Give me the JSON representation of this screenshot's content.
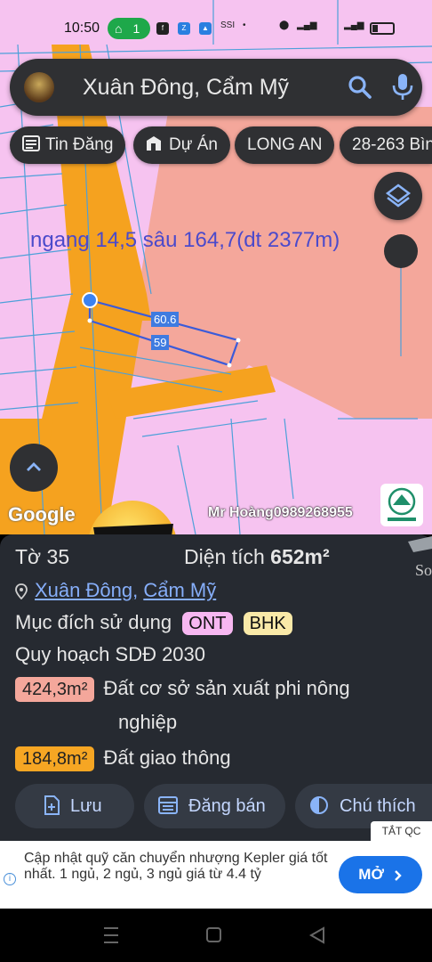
{
  "status": {
    "time": "10:50",
    "hotspot_count": "1"
  },
  "search": {
    "query": "Xuân Đông, Cẩm Mỹ"
  },
  "chips": [
    {
      "label": "Tin Đăng",
      "icon": "newspaper-icon"
    },
    {
      "label": "Dự Án",
      "icon": "building-icon"
    },
    {
      "label": "LONG AN",
      "icon": ""
    },
    {
      "label": "28-263 Bìn",
      "icon": ""
    }
  ],
  "map": {
    "dimension_label": "ngang 14,5 sâu 164,7(dt 2377m)",
    "measure_top": "60.6",
    "measure_bottom": "59",
    "google_logo": "Google",
    "watermark": "Mr Hoàng0989268955",
    "colors": {
      "land_pink": "#f6c3f0",
      "parcel_salmon": "#f4a79b",
      "road_orange": "#f5a21f"
    }
  },
  "panel": {
    "sheet_label": "Tờ 35",
    "area_label": "Diện tích",
    "area_value": "652m²",
    "location": {
      "commune": "Xuân Đông",
      "sep": ", ",
      "district": "Cẩm Mỹ"
    },
    "purpose_label": "Mục đích sử dụng",
    "purpose_tags": [
      "ONT",
      "BHK"
    ],
    "plan_label": "Quy hoạch SDĐ 2030",
    "plan_items": [
      {
        "area": "424,3m²",
        "desc_line1": "Đất cơ sở sản xuất phi nông",
        "desc_line2": "nghiệp",
        "color": "#f4a79b"
      },
      {
        "area": "184,8m²",
        "desc_line1": "Đất giao thông",
        "desc_line2": "",
        "color": "#f6a623"
      }
    ],
    "buttons": {
      "save": "Lưu",
      "sell": "Đăng bán",
      "legend": "Chú thích"
    }
  },
  "ad": {
    "hide_label": "TẮT QC",
    "text": "Cập nhật quỹ căn chuyển nhượng Kepler giá tốt nhất. 1 ngủ, 2 ngủ, 3 ngủ giá từ 4.4 tỷ",
    "open_label": "MỞ"
  }
}
